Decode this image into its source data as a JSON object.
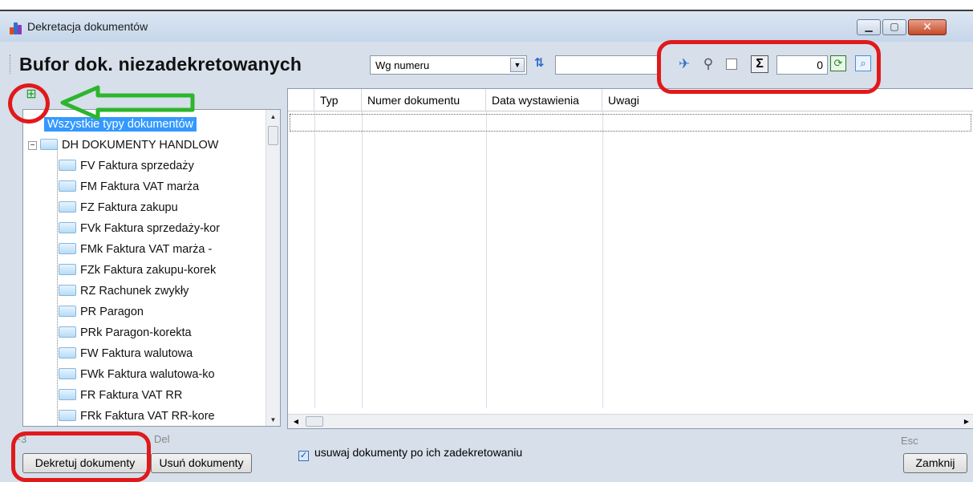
{
  "window": {
    "title": "Dekretacja dokumentów",
    "controls": [
      "minimize",
      "maximize",
      "close"
    ]
  },
  "toolbar": {
    "heading": "Bufor dok. niezadekretowanych",
    "sort_select_value": "Wg numeru",
    "search_value": "",
    "count_value": "0",
    "icons": [
      "pin-icon",
      "filter-icon",
      "checkbox",
      "sigma-icon",
      "refresh-icon",
      "zoom-icon"
    ]
  },
  "tree": {
    "root_label": "Wszystkie typy dokumentów",
    "group_label": "DH  DOKUMENTY HANDLOW",
    "items": [
      {
        "label": "FV  Faktura sprzedaży"
      },
      {
        "label": "FM  Faktura VAT marża"
      },
      {
        "label": "FZ  Faktura zakupu"
      },
      {
        "label": "FVk  Faktura sprzedaży-kor"
      },
      {
        "label": "FMk  Faktura VAT marża -"
      },
      {
        "label": "FZk  Faktura zakupu-korek"
      },
      {
        "label": "RZ  Rachunek zwykły"
      },
      {
        "label": "PR  Paragon"
      },
      {
        "label": "PRk  Paragon-korekta"
      },
      {
        "label": "FW  Faktura walutowa"
      },
      {
        "label": "FWk  Faktura walutowa-ko"
      },
      {
        "label": "FR  Faktura VAT RR"
      },
      {
        "label": "FRk  Faktura VAT RR-kore"
      }
    ]
  },
  "grid": {
    "columns": [
      "",
      "Typ",
      "Numer dokumentu",
      "Data wystawienia",
      "Uwagi"
    ]
  },
  "footer": {
    "hint_f3": "F3",
    "hint_del": "Del",
    "hint_esc": "Esc",
    "decree_button": "Dekretuj dokumenty",
    "delete_button": "Usuń dokumenty",
    "checkbox_label": "usuwaj dokumenty po ich zadekretowaniu",
    "close_button": "Zamknij"
  },
  "colors": {
    "highlight_red": "#e0191b",
    "arrow_green": "#2db52d",
    "selection_blue": "#3399ff"
  }
}
